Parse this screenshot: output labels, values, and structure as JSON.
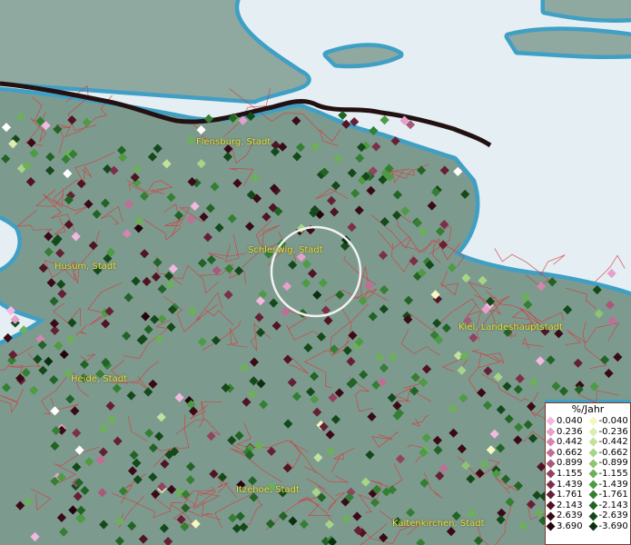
{
  "map": {
    "colors": {
      "sea": "#e4eef3",
      "coast": "#3f9fc4",
      "land": "#7d9a8f",
      "landLight": "#8fa8a0",
      "border": "#231010",
      "admin": "#d63a3a",
      "circle": "#f2f2f2"
    },
    "cities": [
      {
        "id": "flensburg",
        "label": "Flensburg, Stadt"
      },
      {
        "id": "husum",
        "label": "Husum, Stadt"
      },
      {
        "id": "schleswig",
        "label": "Schleswig, Stadt"
      },
      {
        "id": "kiel",
        "label": "Kiel, Landeshauptstadt"
      },
      {
        "id": "heide",
        "label": "Heide, Stadt"
      },
      {
        "id": "itzehoe",
        "label": "Itzehoe, Stadt"
      },
      {
        "id": "kaltenkirchen",
        "label": "Kaltenkirchen, Stadt"
      }
    ]
  },
  "legend": {
    "title": "%/Jahr",
    "rows": [
      {
        "pos": "0.040",
        "posColor": "#f3b8e0",
        "neg": "-0.040",
        "negColor": "#f4f7c0"
      },
      {
        "pos": "0.236",
        "posColor": "#e6a0cb",
        "neg": "-0.236",
        "negColor": "#dbeeb0"
      },
      {
        "pos": "0.442",
        "posColor": "#d486b0",
        "neg": "-0.442",
        "negColor": "#c2e29c"
      },
      {
        "pos": "0.662",
        "posColor": "#c06e95",
        "neg": "-0.662",
        "negColor": "#a8d488"
      },
      {
        "pos": "0.899",
        "posColor": "#a85878",
        "neg": "-0.899",
        "negColor": "#8cc472"
      },
      {
        "pos": "1.155",
        "posColor": "#92435f",
        "neg": "-1.155",
        "negColor": "#6cb059"
      },
      {
        "pos": "1.439",
        "posColor": "#7c2f48",
        "neg": "-1.439",
        "negColor": "#4f9a44"
      },
      {
        "pos": "1.761",
        "posColor": "#662035",
        "neg": "-1.761",
        "negColor": "#357f33"
      },
      {
        "pos": "2.143",
        "posColor": "#501424",
        "neg": "-2.143",
        "negColor": "#226426"
      },
      {
        "pos": "2.639",
        "posColor": "#3a0a17",
        "neg": "-2.639",
        "negColor": "#144a1a"
      },
      {
        "pos": "3.690",
        "posColor": "#26040d",
        "neg": "-3.690",
        "negColor": "#0a3010"
      }
    ]
  }
}
